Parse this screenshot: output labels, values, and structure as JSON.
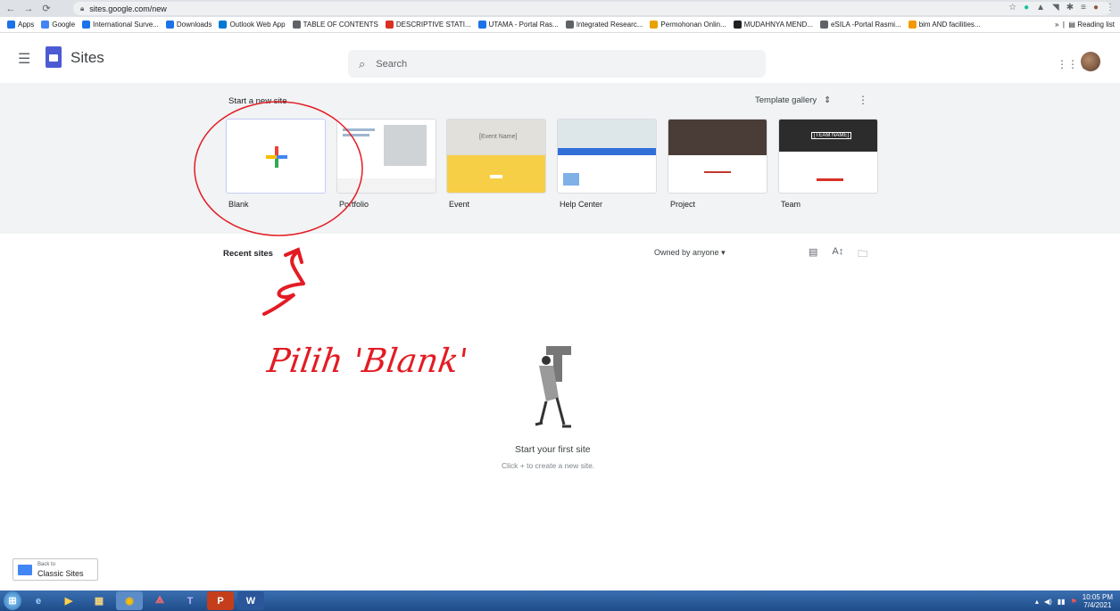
{
  "browser": {
    "url": "sites.google.com/new",
    "bookmarks": [
      "Apps",
      "Google",
      "International Surve...",
      "Downloads",
      "Outlook Web App",
      "TABLE OF CONTENTS",
      "DESCRIPTIVE STATI...",
      "UTAMA - Portal Ras...",
      "Integrated Researc...",
      "Permohonan Onlin...",
      "MUDAHNYA MEND...",
      "eSILA -Portal Rasmi...",
      "bim AND facilities..."
    ],
    "bookmark_colors": [
      "#1a73e8",
      "#4285f4",
      "#1a73e8",
      "#1a73e8",
      "#0078d4",
      "#5f6368",
      "#d93025",
      "#1a73e8",
      "#5f6368",
      "#e8a200",
      "#202124",
      "#5f6368",
      "#f29900"
    ],
    "reading_list": "Reading list"
  },
  "app": {
    "name": "Sites",
    "search_placeholder": "Search"
  },
  "templates": {
    "section_label": "Start a new site",
    "gallery_label": "Template gallery",
    "items": [
      {
        "label": "Blank"
      },
      {
        "label": "Portfolio"
      },
      {
        "label": "Event"
      },
      {
        "label": "Help Center"
      },
      {
        "label": "Project"
      },
      {
        "label": "Team"
      }
    ],
    "event_preview_title": "[Event Name]",
    "team_preview_title": "[TEAM NAME]"
  },
  "recent": {
    "label": "Recent sites",
    "owner_filter": "Owned by anyone",
    "empty_title": "Start your first site",
    "empty_sub": "Click + to create a new site."
  },
  "classic": {
    "line1": "Back to",
    "line2": "Classic Sites"
  },
  "annotation": {
    "text": "Pilih 'Blank'",
    "color": "#e31b23"
  },
  "taskbar": {
    "time": "10:05 PM",
    "date": "7/4/2021"
  }
}
